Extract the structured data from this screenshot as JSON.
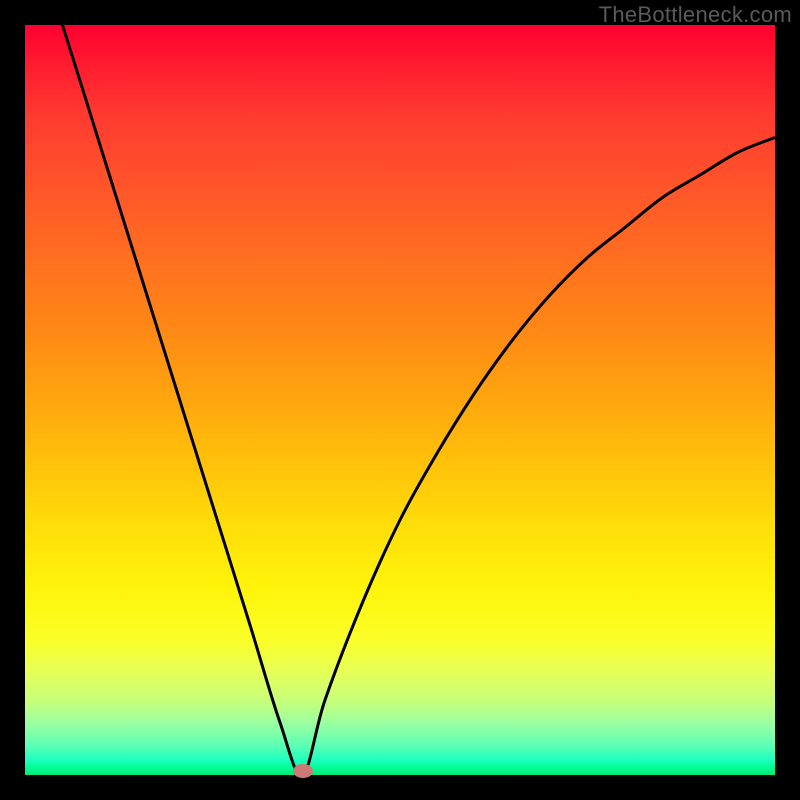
{
  "watermark": "TheBottleneck.com",
  "colors": {
    "background": "#000000",
    "curve_stroke": "#000000",
    "min_marker": "#cd7a76"
  },
  "chart_data": {
    "type": "line",
    "title": "",
    "xlabel": "",
    "ylabel": "",
    "xlim": [
      0,
      100
    ],
    "ylim": [
      0,
      100
    ],
    "grid": false,
    "legend": false,
    "note": "V-shaped bottleneck curve; minimum near x≈37 y≈0",
    "series": [
      {
        "name": "bottleneck",
        "x": [
          0,
          5,
          10,
          15,
          20,
          25,
          30,
          34,
          37,
          40,
          45,
          50,
          55,
          60,
          65,
          70,
          75,
          80,
          85,
          90,
          95,
          100
        ],
        "y": [
          115,
          100,
          84,
          68,
          52,
          36,
          20,
          7,
          0,
          10,
          23,
          34,
          43,
          51,
          58,
          64,
          69,
          73,
          77,
          80,
          83,
          85
        ]
      }
    ],
    "min_point": {
      "x": 37,
      "y": 0
    },
    "gradient_stops": [
      {
        "pos": 0,
        "color": "#ff0030"
      },
      {
        "pos": 25,
        "color": "#ff6020"
      },
      {
        "pos": 50,
        "color": "#ffa60f"
      },
      {
        "pos": 75,
        "color": "#fff40a"
      },
      {
        "pos": 90,
        "color": "#c8ff7a"
      },
      {
        "pos": 100,
        "color": "#00e874"
      }
    ]
  }
}
